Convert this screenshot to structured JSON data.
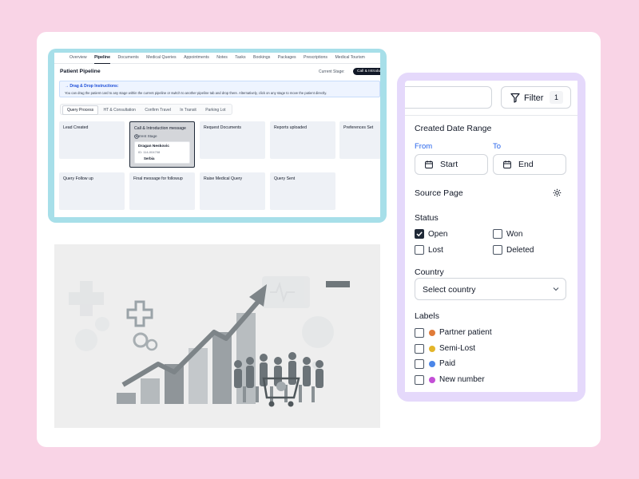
{
  "pipeline": {
    "nav_tabs": [
      "Overview",
      "Pipeline",
      "Documents",
      "Medical Queries",
      "Appointments",
      "Notes",
      "Tasks",
      "Bookings",
      "Packages",
      "Prescriptions",
      "Medical Tourism"
    ],
    "active_nav": "Pipeline",
    "title": "Patient Pipeline",
    "current_stage_label": "Current Stage:",
    "current_stage_value": "Call & Introduction message",
    "instructions_title": "→  Drag & Drop Instructions:",
    "instructions_text": "You can drag the patient card to any stage within the current pipeline or switch to another pipeline tab and drop there. Alternatively, click on any stage to move the patient directly.",
    "sub_tabs": [
      "Query Process",
      "HT & Consultation",
      "Confirm Travel",
      "In Transit",
      "Parking Lot"
    ],
    "active_sub_tab": "Query Process",
    "stages": [
      "Lead Created",
      "Call & Introduction message",
      "Request Documents",
      "Reports uploaded",
      "Preferences Set",
      "Query Follow up",
      "Final message for followup",
      "Raise Medical Query",
      "Query Sent"
    ],
    "patient_card": {
      "stage_tag": "Current Stage",
      "name": "Dragan Neskovic",
      "id": "ID: 114-004708",
      "country": "Serbia"
    }
  },
  "filter_panel": {
    "filter_label": "Filter",
    "filter_count": "1",
    "created_date_range": "Created Date Range",
    "from_label": "From",
    "to_label": "To",
    "start_label": "Start",
    "end_label": "End",
    "source_page": "Source Page",
    "status_title": "Status",
    "status_options": [
      {
        "label": "Open",
        "checked": true
      },
      {
        "label": "Won",
        "checked": false
      },
      {
        "label": "Lost",
        "checked": false
      },
      {
        "label": "Deleted",
        "checked": false
      }
    ],
    "country_title": "Country",
    "country_placeholder": "Select country",
    "labels_title": "Labels",
    "labels": [
      {
        "label": "Partner patient",
        "color": "#e07b39"
      },
      {
        "label": "Semi-Lost",
        "color": "#e3b52a"
      },
      {
        "label": "Paid",
        "color": "#4b86e8"
      },
      {
        "label": "New number",
        "color": "#c34fd6"
      }
    ]
  },
  "colors": {
    "background": "#f9d4e6",
    "pipeline_frame": "#a7dfe9",
    "filter_frame": "#e5d9fb",
    "accent_blue": "#2563eb"
  }
}
